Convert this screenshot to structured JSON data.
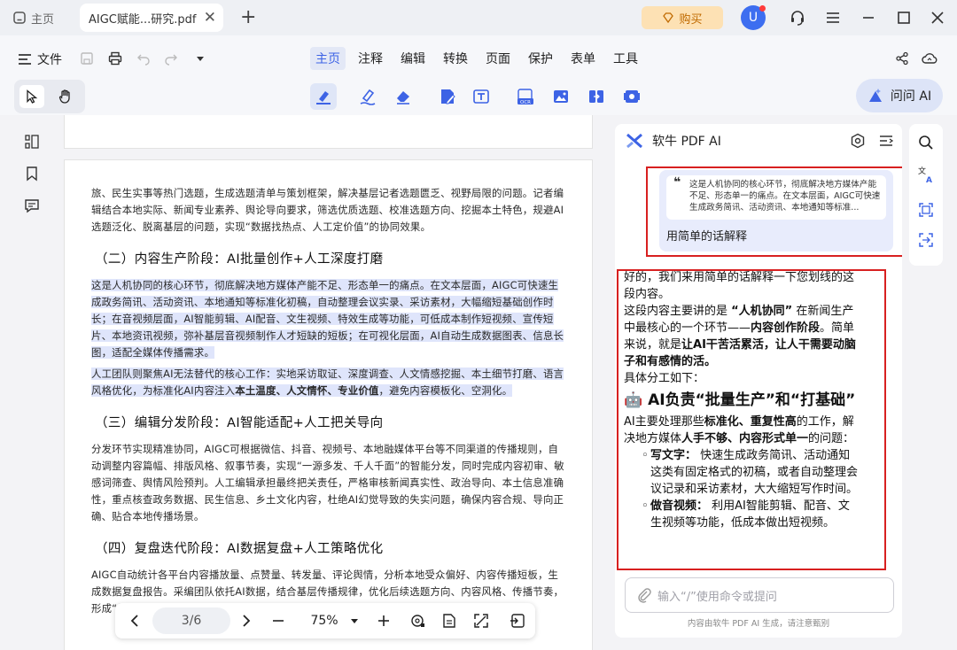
{
  "titlebar": {
    "home_tab": "主页",
    "doc_tab": "AIGC赋能...研究.pdf",
    "buy_button": "购买",
    "avatar_letter": "U"
  },
  "menubar": {
    "file_label": "文件",
    "tabs": [
      "主页",
      "注释",
      "编辑",
      "转换",
      "页面",
      "保护",
      "表单",
      "工具"
    ],
    "active_tab": "主页"
  },
  "toolbar": {
    "ask_ai_label": "问问 AI",
    "tooltip": "高亮"
  },
  "document": {
    "intro": "旅、民生实事等热门选题，生成选题清单与策划框架，解决基层记者选题匮乏、视野局限的问题。记者编辑结合本地实际、新闻专业素养、舆论导向要求，筛选优质选题、校准选题方向、挖掘本土特色，规避AI选题泛化、脱离基层的问题，实现“数据找热点、人工定价值”的协同效果。",
    "h2_1": "（二）内容生产阶段：AI批量创作+人工深度打磨",
    "p_1": "这是人机协同的核心环节，彻底解决地方媒体产能不足、形态单一的痛点。在文本层面，AIGC可快速生成政务简讯、活动资讯、本地通知等标准化初稿，自动整理会议实录、采访素材，大幅缩短基础创作时长；在音视频层面，AI智能剪辑、AI配音、文生视频、特效生成等功能，可低成本制作短视频、宣传短片、本地资讯视频，弥补基层音视频制作人才短缺的短板；在可视化层面，AI自动生成数据图表、信息长图，适配全媒体传播需求。",
    "p_2a": "人工团队则聚焦AI无法替代的核心工作：实地采访取证、深度调查、人文情感挖掘、本土细节打磨、语言风格优化，为标准化AI内容注入",
    "p_2b": "本土温度、人文情怀、专业价值",
    "p_2c": "，避免内容模板化、空洞化。",
    "h2_2": "（三）编辑分发阶段：AI智能适配+人工把关导向",
    "p_3": "分发环节实现精准协同，AIGC可根据微信、抖音、视频号、本地融媒体平台等不同渠道的传播规则，自动调整内容篇幅、排版风格、叙事节奏，实现“一源多发、千人千面”的智能分发，同时完成内容初审、敏感词筛查、舆情风险预判。人工编辑承担最终把关责任，严格审核新闻真实性、政治导向、本土信息准确性，重点核查政务数据、民生信息、乡土文化内容，杜绝AI幻觉导致的失实问题，确保内容合规、导向正确、贴合本地传播场景。",
    "h2_3": "（四）复盘迭代阶段：AI数据复盘+人工策略优化",
    "p_4": "AIGC自动统计各平台内容播放量、点赞量、转发量、评论舆情，分析本地受众偏好、内容传播短板，生成数据复盘报告。采编团队依托AI数据，结合基层传播规律，优化后续选题方向、内容风格、传播节奏，形成“生产—传播—复盘—优化”的闭环流程，持续提升内容传播效能。"
  },
  "pagebar": {
    "page": "3/6",
    "zoom": "75%"
  },
  "ai_panel": {
    "title": "软牛 PDF AI",
    "quote": "这是人机协同的核心环节，彻底解决地方媒体产能不足、形态单一的痛点。在文本层面，AIGC可快速生成政务简讯、活动资讯、本地通知等标准...",
    "question": "用简单的话解释",
    "answer_1": "好的，我们来用简单的话解释一下您划线的这段内容。",
    "answer_2a": "这段内容主要讲的是 ",
    "answer_2b": "“人机协同”",
    "answer_2c": " 在新闻生产中最核心的一个环节——",
    "answer_2d": "内容创作阶段",
    "answer_2e": "。简单来说，就是",
    "answer_2f": "让AI干苦活累活，让人干需要动脑子和有感情的活。",
    "answer_3": "具体分工如下：",
    "answer_h3": "🤖 AI负责“批量生产”和“打基础”",
    "answer_4a": "AI主要处理那些",
    "answer_4b": "标准化、重复性高",
    "answer_4c": "的工作，解决地方媒体",
    "answer_4d": "人手不够、内容形式单一",
    "answer_4e": "的问题：",
    "li_1_label": "写文字：",
    "li_1_text": " 快速生成政务简讯、活动通知这类有固定格式的初稿，或者自动整理会议记录和采访素材，大大缩短写作时间。",
    "li_2_label": "做音视频：",
    "li_2_text": " 利用AI智能剪辑、配音、文生视频等功能，低成本做出短视频。",
    "input_placeholder": "输入“/”使用命令或提问",
    "footer": "内容由软牛 PDF AI 生成，请注意甄别"
  }
}
